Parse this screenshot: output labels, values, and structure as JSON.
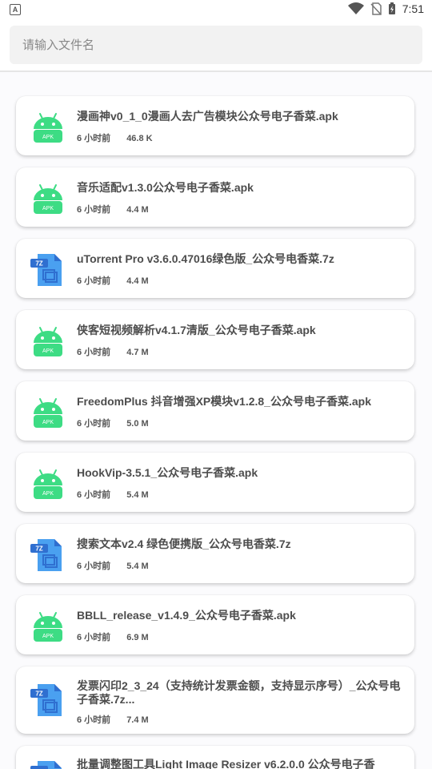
{
  "status_bar": {
    "time": "7:51",
    "left_icon": "A"
  },
  "search": {
    "placeholder": "请输入文件名"
  },
  "files": [
    {
      "name": "漫画神v0_1_0漫画人去广告模块公众号电子香菜.apk",
      "time": "6 小时前",
      "size": "46.8 K",
      "type": "apk"
    },
    {
      "name": "音乐适配v1.3.0公众号电子香菜.apk",
      "time": "6 小时前",
      "size": "4.4 M",
      "type": "apk"
    },
    {
      "name": "uTorrent Pro v3.6.0.47016绿色版_公众号电香菜.7z",
      "time": "6 小时前",
      "size": "4.4 M",
      "type": "7z"
    },
    {
      "name": "侠客短视频解析v4.1.7清版_公众号电子香菜.apk",
      "time": "6 小时前",
      "size": "4.7 M",
      "type": "apk"
    },
    {
      "name": "FreedomPlus 抖音增强XP模块v1.2.8_公众号电子香菜.apk",
      "time": "6 小时前",
      "size": "5.0 M",
      "type": "apk"
    },
    {
      "name": "HookVip-3.5.1_公众号电子香菜.apk",
      "time": "6 小时前",
      "size": "5.4 M",
      "type": "apk"
    },
    {
      "name": "搜索文本v2.4 绿色便携版_公众号电香菜.7z",
      "time": "6 小时前",
      "size": "5.4 M",
      "type": "7z"
    },
    {
      "name": "BBLL_release_v1.4.9_公众号电子香菜.apk",
      "time": "6 小时前",
      "size": "6.9 M",
      "type": "apk"
    },
    {
      "name": "发票闪印2_3_24（支持统计发票金额，支持显示序号）_公众号电子香菜.7z...",
      "time": "6 小时前",
      "size": "7.4 M",
      "type": "7z"
    },
    {
      "name": "批量调整图工具Light Image Resizer v6.2.0.0 公众号电子香",
      "time": "",
      "size": "",
      "type": "7z"
    }
  ],
  "icons": {
    "apk_label": "APK",
    "zip_label": "7Z"
  },
  "colors": {
    "apk_green": "#3ddc84",
    "zip_blue": "#4aa0f0",
    "zip_dark": "#2f6fd0"
  }
}
